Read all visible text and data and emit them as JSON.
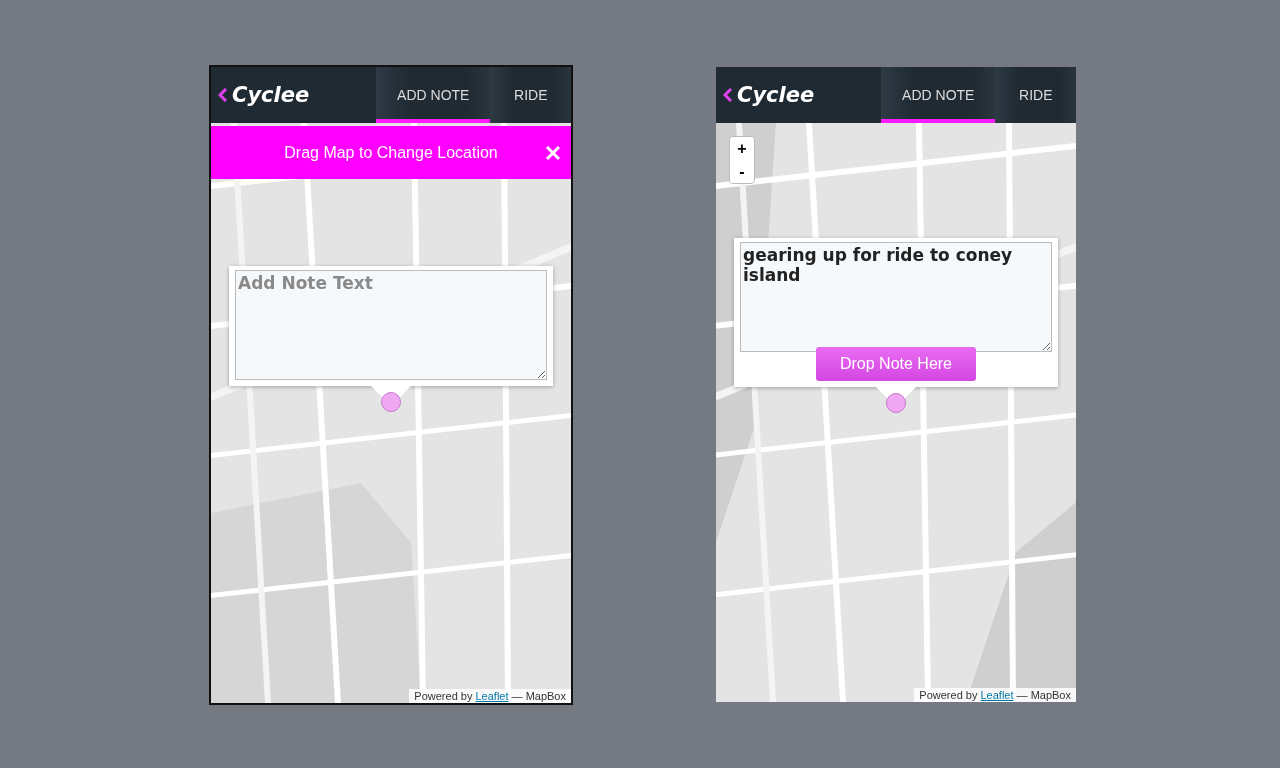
{
  "phones": [
    {
      "brand": "Cyclee",
      "tabs": [
        {
          "label": "ADD NOTE",
          "selected": true
        },
        {
          "label": "RIDE",
          "selected": false
        }
      ],
      "banner": {
        "text": "Drag Map to Change Location"
      },
      "note": {
        "placeholder": "Add Note Text"
      },
      "attribution": {
        "prefix": "Powered by",
        "link": "Leaflet",
        "suffix": "— MapBox"
      }
    },
    {
      "brand": "Cyclee",
      "tabs": [
        {
          "label": "ADD NOTE",
          "selected": true
        },
        {
          "label": "RIDE",
          "selected": false
        }
      ],
      "zoom": [
        "+",
        "-"
      ],
      "note": {
        "value": "gearing up for ride to coney island",
        "button": "Drop Note Here"
      },
      "attribution": {
        "prefix": "Powered by",
        "link": "Leaflet",
        "suffix": "— MapBox"
      }
    }
  ]
}
